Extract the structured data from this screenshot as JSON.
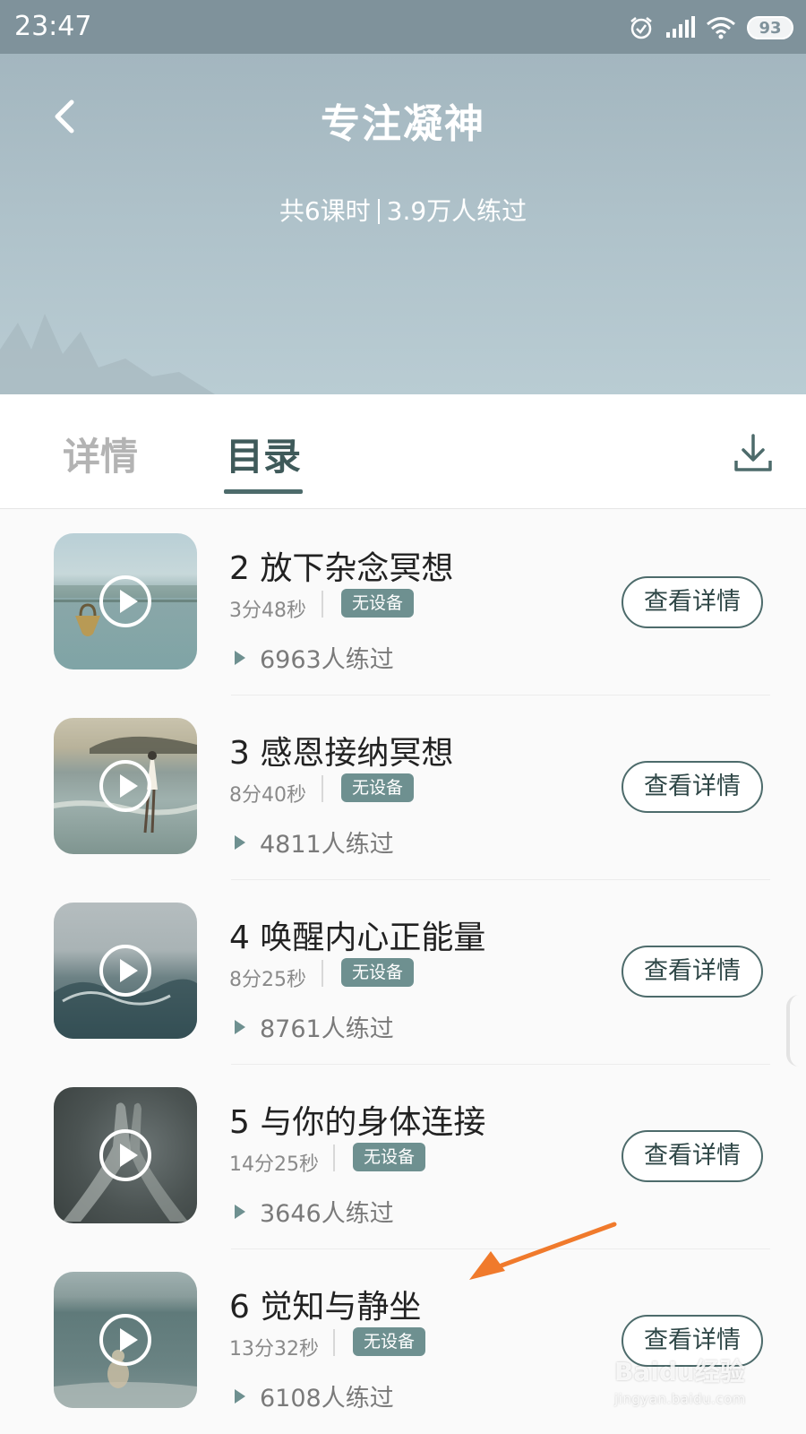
{
  "status_bar": {
    "time": "23:47",
    "battery": "93"
  },
  "header": {
    "title": "专注凝神",
    "lessons": "共6课时",
    "practiced": "3.9万人练过"
  },
  "tabs": {
    "details": "详情",
    "catalog": "目录"
  },
  "items": [
    {
      "title": "2 放下杂念冥想",
      "duration": "3分48秒",
      "badge": "无设备",
      "practiced": "6963人练过",
      "button": "查看详情"
    },
    {
      "title": "3 感恩接纳冥想",
      "duration": "8分40秒",
      "badge": "无设备",
      "practiced": "4811人练过",
      "button": "查看详情"
    },
    {
      "title": "4 唤醒内心正能量",
      "duration": "8分25秒",
      "badge": "无设备",
      "practiced": "8761人练过",
      "button": "查看详情"
    },
    {
      "title": "5 与你的身体连接",
      "duration": "14分25秒",
      "badge": "无设备",
      "practiced": "3646人练过",
      "button": "查看详情"
    },
    {
      "title": "6 觉知与静坐",
      "duration": "13分32秒",
      "badge": "无设备",
      "practiced": "6108人练过",
      "button": "查看详情"
    }
  ],
  "watermark": {
    "brand": "Baidu经验",
    "url": "jingyan.baidu.com"
  },
  "colors": {
    "accent": "#4d6b6b",
    "badge": "#6e9090",
    "annotation_arrow": "#f07a2c"
  }
}
